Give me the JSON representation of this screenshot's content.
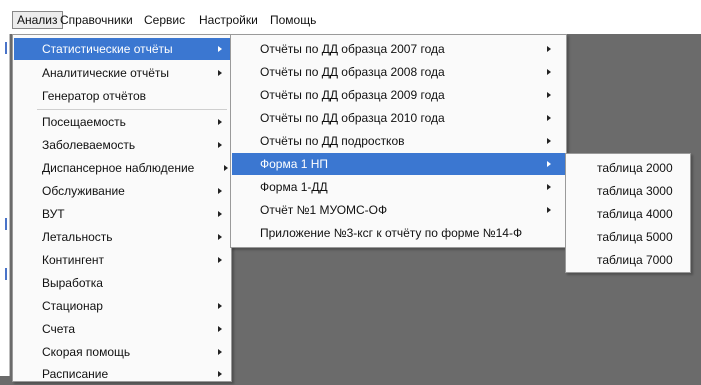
{
  "menubar": {
    "items": [
      {
        "label": "Анализ",
        "active": true
      },
      {
        "label": "Справочники"
      },
      {
        "label": "Сервис"
      },
      {
        "label": "Настройки"
      },
      {
        "label": "Помощь"
      }
    ]
  },
  "menu_analysis": {
    "items": [
      {
        "label": "Статистические отчёты",
        "submenu": true,
        "selected": true
      },
      {
        "label": "Аналитические отчёты",
        "submenu": true
      },
      {
        "label": "Генератор отчётов",
        "submenu": false
      },
      {
        "label": "Посещаемость",
        "submenu": true
      },
      {
        "label": "Заболеваемость",
        "submenu": true
      },
      {
        "label": "Диспансерное наблюдение",
        "submenu": true
      },
      {
        "label": "Обслуживание",
        "submenu": true
      },
      {
        "label": "ВУТ",
        "submenu": true
      },
      {
        "label": "Летальность",
        "submenu": true
      },
      {
        "label": "Контингент",
        "submenu": true
      },
      {
        "label": "Выработка",
        "submenu": false
      },
      {
        "label": "Стационар",
        "submenu": true
      },
      {
        "label": "Счета",
        "submenu": true
      },
      {
        "label": "Скорая помощь",
        "submenu": true
      },
      {
        "label": "Расписание",
        "submenu": true
      }
    ]
  },
  "menu_stat_reports": {
    "items": [
      {
        "label": "Отчёты по ДД образца 2007 года",
        "submenu": true
      },
      {
        "label": "Отчёты по ДД образца 2008 года",
        "submenu": true
      },
      {
        "label": "Отчёты по ДД образца 2009 года",
        "submenu": true
      },
      {
        "label": "Отчёты по ДД образца 2010 года",
        "submenu": true
      },
      {
        "label": "Отчёты по ДД подростков",
        "submenu": true
      },
      {
        "label": "Форма 1 НП",
        "submenu": true,
        "selected": true
      },
      {
        "label": "Форма 1-ДД",
        "submenu": true
      },
      {
        "label": "Отчёт №1 МУОМС-ОФ",
        "submenu": true
      },
      {
        "label": "Приложение №3-ксг к отчёту по форме №14-Ф",
        "submenu": false
      }
    ]
  },
  "menu_form1np": {
    "items": [
      {
        "label": "таблица 2000"
      },
      {
        "label": "таблица 3000"
      },
      {
        "label": "таблица 4000"
      },
      {
        "label": "таблица 5000"
      },
      {
        "label": "таблица 7000"
      }
    ]
  },
  "colors": {
    "selection": "#3b77d1",
    "workspace": "#6b6b6b",
    "menu_bg": "#fafafa"
  }
}
